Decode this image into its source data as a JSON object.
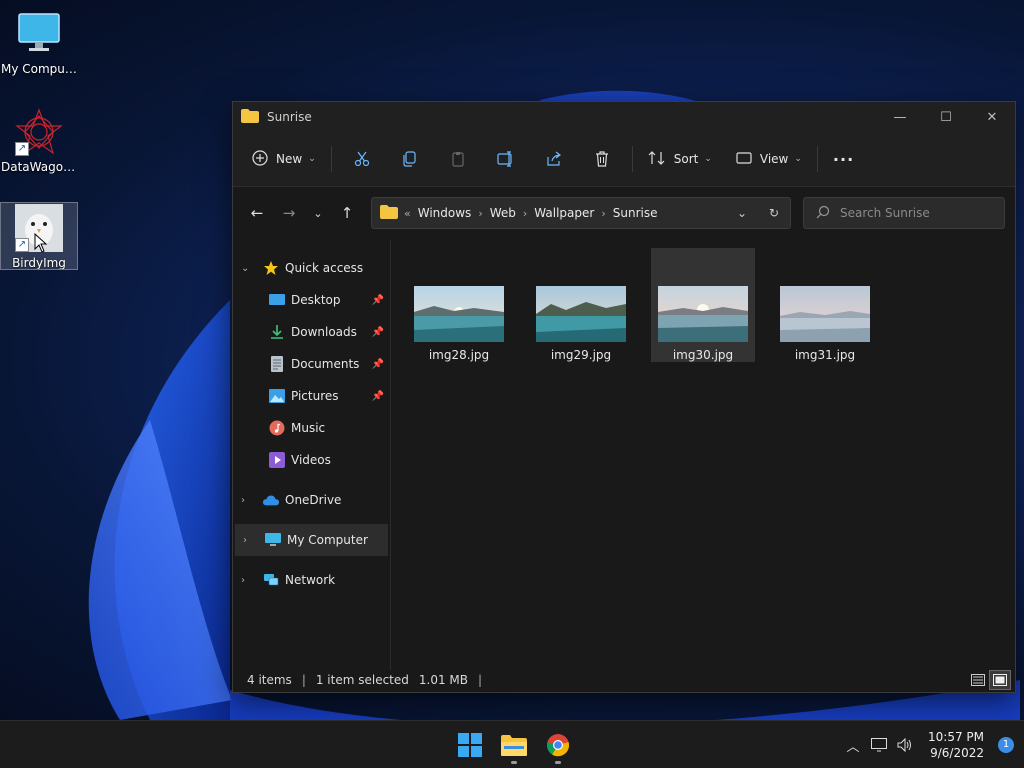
{
  "desktop": {
    "icons": [
      {
        "label": "My Computer"
      },
      {
        "label": "DataWagon..."
      },
      {
        "label": "BirdyImg"
      }
    ]
  },
  "window": {
    "title": "Sunrise",
    "toolbar": {
      "new_label": "New",
      "sort_label": "Sort",
      "view_label": "View",
      "more": "···"
    },
    "address": {
      "crumbs": [
        "Windows",
        "Web",
        "Wallpaper",
        "Sunrise"
      ]
    },
    "search": {
      "placeholder": "Search Sunrise"
    },
    "sidebar": {
      "quick_access": "Quick access",
      "items": [
        "Desktop",
        "Downloads",
        "Documents",
        "Pictures",
        "Music",
        "Videos"
      ],
      "onedrive": "OneDrive",
      "my_computer": "My Computer",
      "network": "Network"
    },
    "files": [
      {
        "name": "img28.jpg"
      },
      {
        "name": "img29.jpg"
      },
      {
        "name": "img30.jpg"
      },
      {
        "name": "img31.jpg"
      }
    ],
    "status": {
      "count": "4 items",
      "selected": "1 item selected",
      "size": "1.01 MB"
    }
  },
  "taskbar": {
    "time": "10:57 PM",
    "date": "9/6/2022",
    "notifications": "1"
  }
}
